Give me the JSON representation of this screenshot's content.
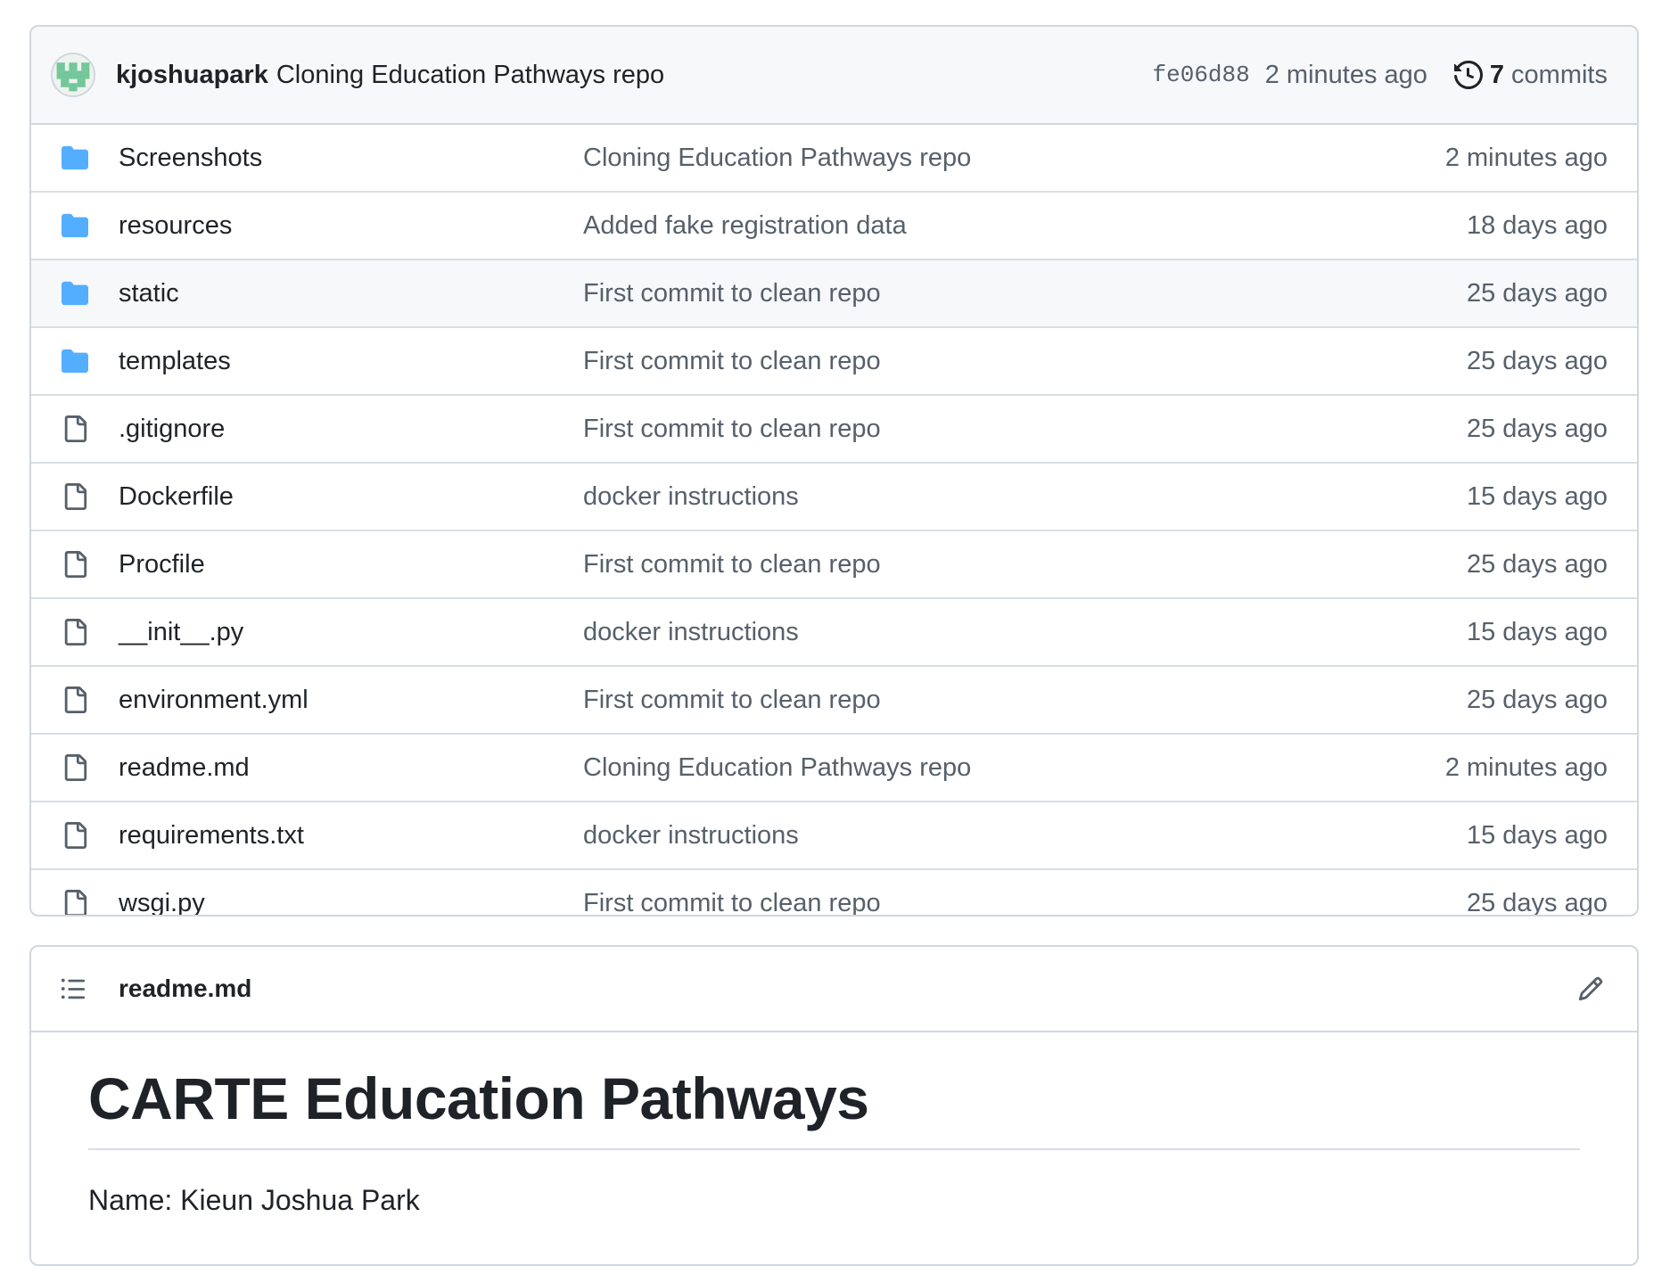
{
  "latest_commit": {
    "author": "kjoshuapark",
    "message": "Cloning Education Pathways repo",
    "sha": "fe06d88",
    "time": "2 minutes ago",
    "commit_count": "7",
    "commits_label": "commits"
  },
  "files": [
    {
      "name": "Screenshots",
      "type": "folder",
      "message": "Cloning Education Pathways repo",
      "age": "2 minutes ago"
    },
    {
      "name": "resources",
      "type": "folder",
      "message": "Added fake registration data",
      "age": "18 days ago"
    },
    {
      "name": "static",
      "type": "folder",
      "message": "First commit to clean repo",
      "age": "25 days ago"
    },
    {
      "name": "templates",
      "type": "folder",
      "message": "First commit to clean repo",
      "age": "25 days ago"
    },
    {
      "name": ".gitignore",
      "type": "file",
      "message": "First commit to clean repo",
      "age": "25 days ago"
    },
    {
      "name": "Dockerfile",
      "type": "file",
      "message": "docker instructions",
      "age": "15 days ago"
    },
    {
      "name": "Procfile",
      "type": "file",
      "message": "First commit to clean repo",
      "age": "25 days ago"
    },
    {
      "name": "__init__.py",
      "type": "file",
      "message": "docker instructions",
      "age": "15 days ago"
    },
    {
      "name": "environment.yml",
      "type": "file",
      "message": "First commit to clean repo",
      "age": "25 days ago"
    },
    {
      "name": "readme.md",
      "type": "file",
      "message": "Cloning Education Pathways repo",
      "age": "2 minutes ago"
    },
    {
      "name": "requirements.txt",
      "type": "file",
      "message": "docker instructions",
      "age": "15 days ago"
    },
    {
      "name": "wsgi.py",
      "type": "file",
      "message": "First commit to clean repo",
      "age": "25 days ago"
    }
  ],
  "hovered_row": "static",
  "readme": {
    "filename": "readme.md",
    "heading": "CARTE Education Pathways",
    "first_line": "Name: Kieun Joshua Park"
  },
  "colors": {
    "folder": "#54aeff",
    "file_icon": "#57606a",
    "border": "#d0d7de",
    "header_bg": "#f6f8fa",
    "avatar_green": "#73c79a"
  },
  "icons": {
    "folder": "folder-icon",
    "file": "file-icon",
    "history": "history-icon",
    "toc": "list-unordered-icon",
    "edit": "pencil-icon"
  }
}
